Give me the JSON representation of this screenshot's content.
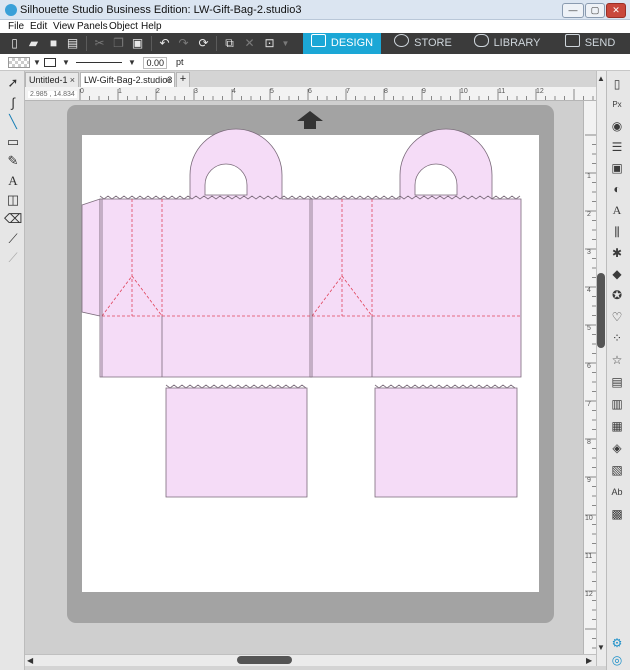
{
  "window": {
    "title": "Silhouette Studio Business Edition: LW-Gift-Bag-2.studio3",
    "controls": {
      "minimize": "—",
      "maximize": "▢",
      "close": "✕"
    }
  },
  "menu": [
    "File",
    "Edit",
    "View",
    "Panels",
    "Object",
    "Help"
  ],
  "toolbar": {
    "tools": [
      "new-icon",
      "open-icon",
      "save-icon",
      "print-icon",
      "cut-icon",
      "copy-icon",
      "paste-icon",
      "undo-icon",
      "redo-icon",
      "redraw-icon",
      "group-icon",
      "ungroup-icon",
      "compound-icon"
    ],
    "nav_tabs": [
      {
        "label": "DESIGN",
        "icon": "design-icon",
        "active": true
      },
      {
        "label": "STORE",
        "icon": "store-icon",
        "active": false
      },
      {
        "label": "LIBRARY",
        "icon": "library-icon",
        "active": false
      },
      {
        "label": "SEND",
        "icon": "send-icon",
        "active": false
      }
    ],
    "active_color": "#1ba7d6"
  },
  "line_settings": {
    "width": "0.00",
    "unit": "pt"
  },
  "doc_tabs": [
    {
      "label": "Untitled-1",
      "active": false
    },
    {
      "label": "LW-Gift-Bag-2.studio3",
      "active": true
    }
  ],
  "add_tab_label": "+",
  "ruler": {
    "coordinates": "2.985 , 14.834",
    "h_numbers": [
      "0",
      "1",
      "2",
      "3",
      "4",
      "5",
      "6",
      "7",
      "8",
      "9",
      "10",
      "11",
      "12"
    ],
    "v_numbers": [
      "1",
      "2",
      "3",
      "4",
      "5",
      "6",
      "7",
      "8",
      "9",
      "10",
      "11",
      "12"
    ]
  },
  "left_tools": [
    "select-icon",
    "point-edit-icon",
    "line-icon",
    "rectangle-icon",
    "draw-icon",
    "text-icon",
    "fill-icon",
    "eraser-icon",
    "knife-icon",
    "eyedropper-icon"
  ],
  "right_panel": [
    "page-setup-icon",
    "pixscan-icon",
    "fill-panel-icon",
    "line-style-icon",
    "stroke-icon",
    "gradient-icon",
    "align-icon",
    "replicate-icon",
    "transform-icon",
    "modify-icon",
    "rhinestone-icon",
    "trace-icon",
    "shapes-icon",
    "offset-icon",
    "layers-icon",
    "sketch-icon",
    "emboss-icon",
    "fold-icon",
    "font-icon",
    "pattern-icon"
  ],
  "colors": {
    "shape_fill": "#f5dcf7",
    "shape_stroke": "#7a6a7a",
    "perforation": "#e0445c",
    "mat": "#a3a3a3"
  }
}
